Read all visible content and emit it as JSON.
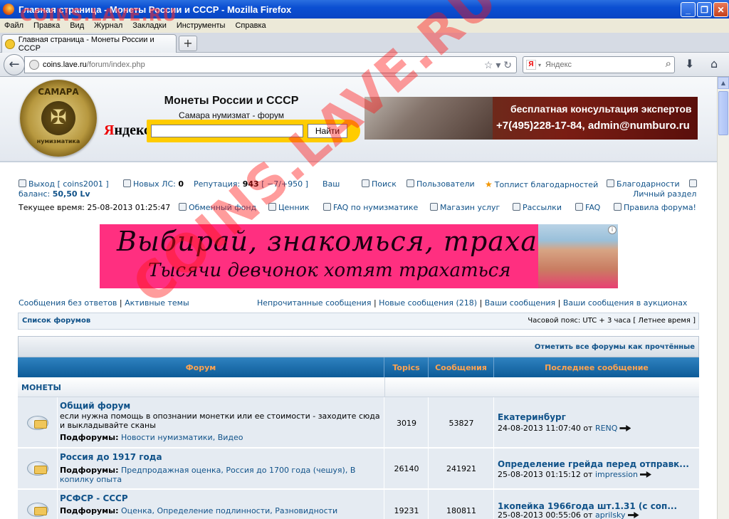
{
  "window": {
    "title": "Главная страница - Монеты России и СССР - Mozilla Firefox",
    "buttons": {
      "minimize": "_",
      "maximize": "❐",
      "close": "✕"
    }
  },
  "menu": [
    "Файл",
    "Правка",
    "Вид",
    "Журнал",
    "Закладки",
    "Инструменты",
    "Справка"
  ],
  "tab": {
    "label": "Главная страница - Монеты России и СССР",
    "new_tab": "+"
  },
  "nav": {
    "url_host": "coins.lave.ru",
    "url_path": "/forum/index.php",
    "search_placeholder": "Яндекс",
    "search_engine_glyph": "Я"
  },
  "header": {
    "logo_top": "САМАРА",
    "logo_bottom": "нумизматика",
    "title": "Монеты России и СССР",
    "subtitle": "Самара нумизмат - форум",
    "yandex_logo": {
      "first": "Я",
      "rest": "ндекс"
    },
    "yandex_button": "Найти",
    "banner": {
      "line1": "бесплатная консультация экспертов",
      "line2": "+7(495)228-17-84, admin@numburo.ru"
    }
  },
  "user_bar": {
    "logout": "Выход [ coins2001 ]",
    "new_pm_label": "Новых ЛС:",
    "new_pm_count": "0",
    "reputation_label": "Репутация:",
    "reputation_value": "943",
    "reputation_delta": "[ −7/+950 ]",
    "balance_prefix": "Ваш",
    "balance_label": "баланс:",
    "balance_value": "50,50 Lv",
    "search": "Поиск",
    "users": "Пользователи",
    "toplist": "Топлист благодарностей",
    "thanks": "Благодарности",
    "personal": "Личный раздел",
    "current_time": "Текущее время: 25-08-2013 01:25:47",
    "exchange": "Обменный фонд",
    "price": "Ценник",
    "faq_numismatics": "FAQ по нумизматике",
    "shop": "Магазин услуг",
    "mailings": "Рассылки",
    "faq": "FAQ",
    "rules": "Правила форума!"
  },
  "ad": {
    "line1": "Выбирай, знакомься, трахай!",
    "line2": "Тысячи девчонок хотят трахаться",
    "info": "i"
  },
  "quick_links": {
    "unanswered": "Сообщения без ответов",
    "sep1": "|",
    "active": "Активные темы",
    "unread": "Непрочитанные сообщения",
    "sep2": "|",
    "new_posts": "Новые сообщения (218)",
    "sep3": "|",
    "your_posts": "Ваши сообщения",
    "sep4": "|",
    "your_auction_posts": "Ваши сообщения в аукционах"
  },
  "breadcrumb": {
    "label": "Список форумов",
    "timezone": "Часовой пояс: UTC + 3 часа [ Летнее время ]"
  },
  "forum": {
    "mark_read": "Отметить все форумы как прочтённые",
    "headers": [
      "Форум",
      "Topics",
      "Сообщения",
      "Последнее сообщение"
    ],
    "category": "МОНЕТЫ",
    "subforums_label": "Подфорумы:",
    "rows": [
      {
        "title": "Общий форум",
        "desc": "если нужна помощь в опознании монетки или ее стоимости - заходите сюда и выкладывайте сканы",
        "subforums": "Новости нумизматики, Видео",
        "topics": "3019",
        "posts": "53827",
        "last_title": "Екатеринбург",
        "last_date": "24-08-2013 11:07:40 от",
        "last_user": "RENQ"
      },
      {
        "title": "Россия до 1917 года",
        "desc": "",
        "subforums": "Предпродажная оценка, Россия до 1700 года (чешуя), В копилку опыта",
        "topics": "26140",
        "posts": "241921",
        "last_title": "Определение грейда перед отправк...",
        "last_date": "25-08-2013 01:15:12 от",
        "last_user": "impression"
      },
      {
        "title": "РСФСР - СССР",
        "desc": "",
        "subforums": "Оценка, Определение подлинности, Разновидности",
        "topics": "19231",
        "posts": "180811",
        "last_title": "1копейка 1966года шт.1.31 (с соп...",
        "last_date": "25-08-2013 00:55:06 от",
        "last_user": "aprilsky"
      }
    ]
  },
  "watermarks": {
    "top": "COINS.LAVE.RU",
    "diagonal": "COINS.LAVE.RU"
  },
  "colors": {
    "link": "#105289",
    "table_header": "#0d5b98",
    "header_text": "#ffa34f",
    "row_bg": "#e5ebf2",
    "ad_bg": "#ff2f80",
    "titlebar": "#0b4fd2"
  }
}
